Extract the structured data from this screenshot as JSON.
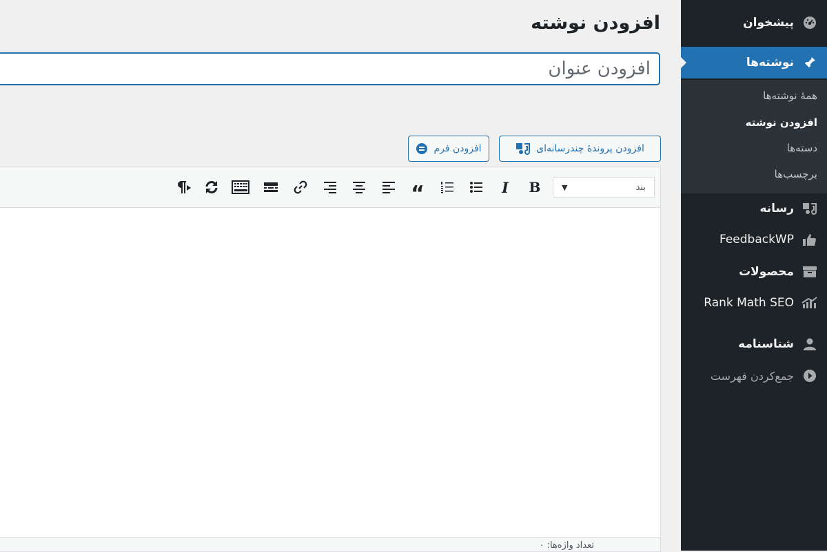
{
  "sidebar": {
    "items": [
      {
        "label": "پیشخوان",
        "icon": "dashboard-icon"
      },
      {
        "label": "نوشته‌ها",
        "icon": "pushpin-icon",
        "active": true
      },
      {
        "label": "رسانه",
        "icon": "media-icon"
      },
      {
        "label": "FeedbackWP",
        "icon": "thumbs-up-icon"
      },
      {
        "label": "محصولات",
        "icon": "archive-box-icon"
      },
      {
        "label": "Rank Math SEO",
        "icon": "rank-math-icon"
      },
      {
        "label": "شناسنامه",
        "icon": "user-icon"
      },
      {
        "label": "جمع‌کردن فهرست",
        "icon": "collapse-menu-icon"
      }
    ],
    "submenu": [
      {
        "label": "همهٔ نوشته‌ها"
      },
      {
        "label": "افزودن نوشته",
        "current": true
      },
      {
        "label": "دسته‌ها"
      },
      {
        "label": "برچسب‌ها"
      }
    ],
    "active_color": "#2271b1",
    "background": "#1d2327"
  },
  "page": {
    "title": "افزودن نوشته",
    "title_placeholder": "افزودن عنوان"
  },
  "buttons": {
    "add_media": "افزودن پروندهٔ چندرسانه‌ای",
    "add_form": "افزودن فرم"
  },
  "editor": {
    "format_select": "بند",
    "toolbar": [
      "bold-button",
      "italic-button",
      "bulleted-list-button",
      "numbered-list-button",
      "blockquote-button",
      "align-left-button",
      "align-center-button",
      "align-right-button",
      "link-button",
      "read-more-button",
      "toolbar-toggle-button",
      "refresh-button",
      "rtl-button"
    ],
    "toolbar_text": {
      "bold": "B",
      "italic": "I",
      "quote": "“"
    },
    "word_count": "تعداد واژه‌ها: ۰"
  }
}
